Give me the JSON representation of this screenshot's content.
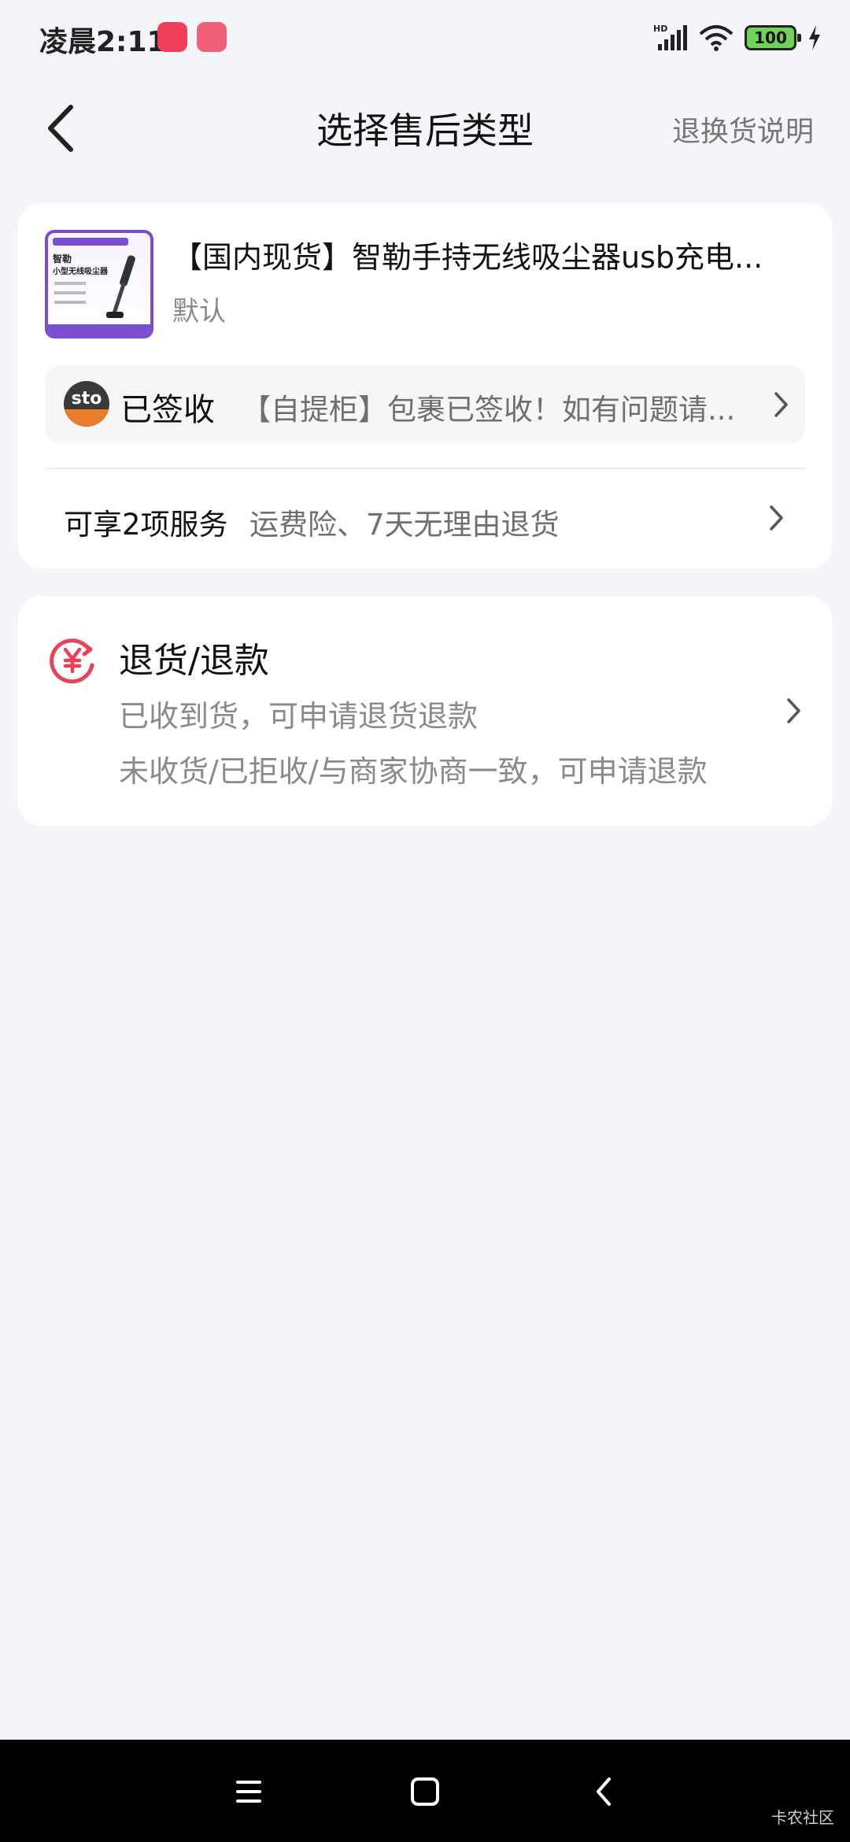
{
  "status_bar": {
    "time": "凌晨2:11",
    "battery": "100",
    "signal_label": "HD"
  },
  "header": {
    "title": "选择售后类型",
    "right_link": "退换货说明"
  },
  "order": {
    "product_title": "【国内现货】智勒手持无线吸尘器usb充电...",
    "product_spec": "默认",
    "thumb_text": {
      "line1": "智勒",
      "line2": "小型无线吸尘器"
    },
    "logistics_status": "已签收",
    "logistics_message": "【自提柜】包裹已签收！如有问题请...",
    "courier_logo": "sto",
    "services_lead": "可享2项服务",
    "services_detail": "运费险、7天无理由退货"
  },
  "options": [
    {
      "icon": "yen-return-icon",
      "title": "退货/退款",
      "desc1": "已收到货，可申请退货退款",
      "desc2": "未收货/已拒收/与商家协商一致，可申请退款"
    }
  ],
  "watermark": "卡农社区",
  "colors": {
    "accent": "#e8415a",
    "background": "#f4f5f9",
    "card": "#ffffff",
    "secondary_text": "#8a8a8a"
  }
}
